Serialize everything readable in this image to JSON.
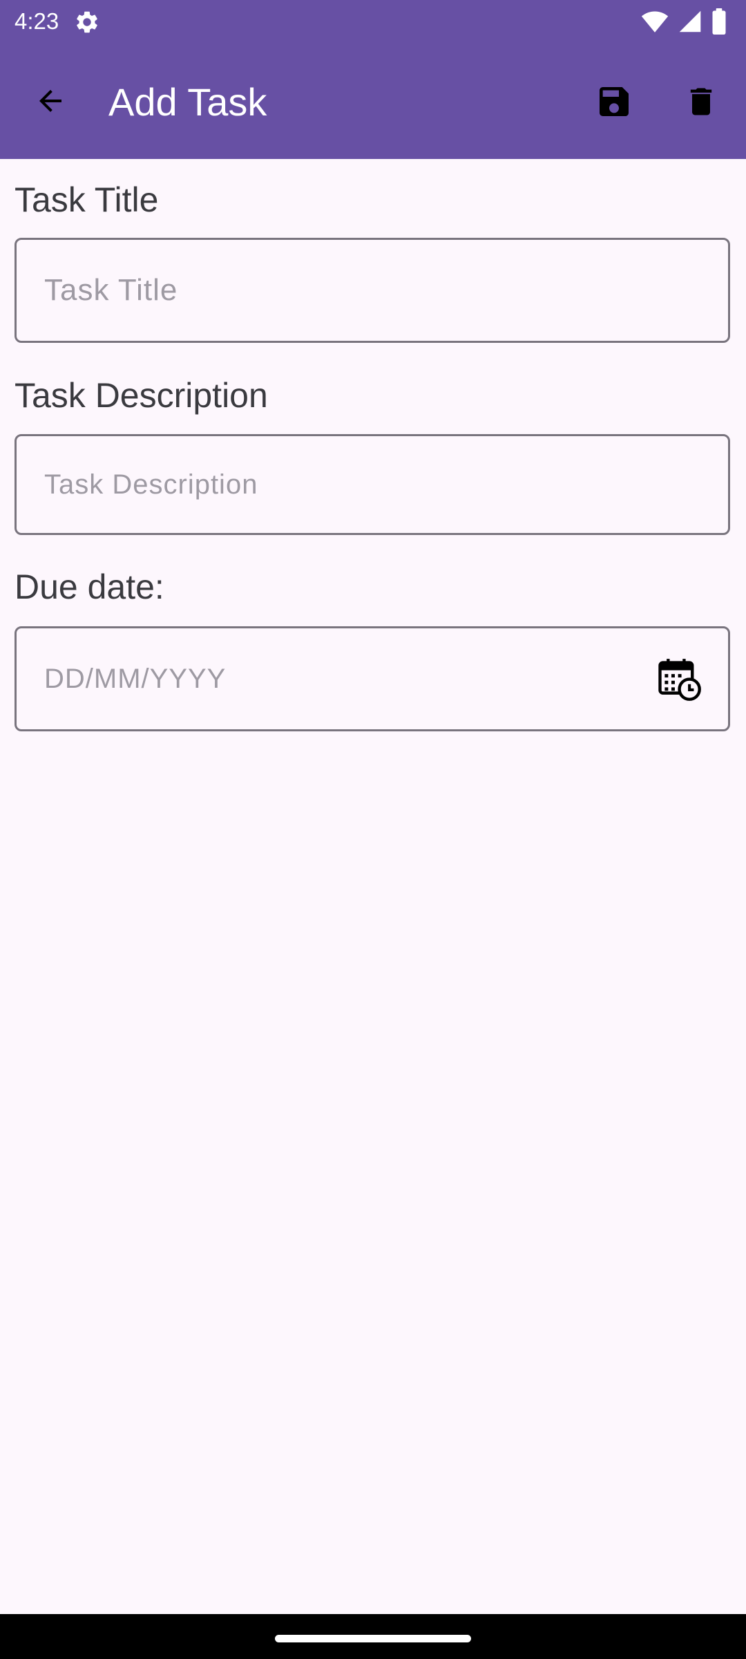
{
  "status_bar": {
    "time": "4:23",
    "icons": [
      "settings-icon",
      "wifi-icon",
      "cellular-signal-icon",
      "battery-icon"
    ]
  },
  "app_bar": {
    "title": "Add Task",
    "back_icon": "arrow-back-icon",
    "save_icon": "save-icon",
    "delete_icon": "delete-icon"
  },
  "form": {
    "title": {
      "label": "Task Title",
      "placeholder": "Task Title",
      "value": ""
    },
    "description": {
      "label": "Task Description",
      "placeholder": "Task Description",
      "value": ""
    },
    "due_date": {
      "label": "Due date:",
      "placeholder": "DD/MM/YYYY",
      "value": "",
      "icon": "calendar-clock-icon"
    }
  },
  "colors": {
    "app_bar": "#6750A4",
    "background": "#FDF7FD",
    "field_border": "#79747E",
    "label_text": "#3a3a3f",
    "placeholder_text": "#9e9aa3",
    "nav_bar": "#000000"
  }
}
